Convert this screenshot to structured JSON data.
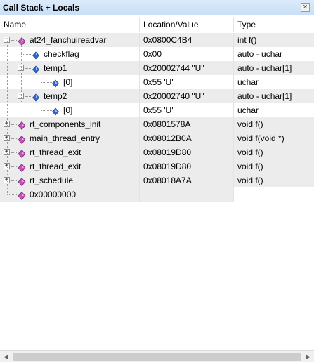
{
  "window": {
    "title": "Call Stack + Locals",
    "close_glyph": "×"
  },
  "columns": {
    "name": "Name",
    "location": "Location/Value",
    "type": "Type"
  },
  "rows": [
    {
      "name": "at24_fanchuireadvar",
      "location": "0x0800C4B4",
      "type": "int f()",
      "icon": "function-icon",
      "expander": "−"
    },
    {
      "name": "checkflag",
      "location": "0x00",
      "type": "auto - uchar",
      "icon": "variable-icon",
      "expander": ""
    },
    {
      "name": "temp1",
      "location": "0x20002744 \"U\"",
      "type": "auto - uchar[1]",
      "icon": "variable-icon",
      "expander": "−"
    },
    {
      "name": "[0]",
      "location": "0x55 'U'",
      "type": "uchar",
      "icon": "variable-icon",
      "expander": ""
    },
    {
      "name": "temp2",
      "location": "0x20002740 \"U\"",
      "type": "auto - uchar[1]",
      "icon": "variable-icon",
      "expander": "−"
    },
    {
      "name": "[0]",
      "location": "0x55 'U'",
      "type": "uchar",
      "icon": "variable-icon",
      "expander": ""
    },
    {
      "name": "rt_components_init",
      "location": "0x0801578A",
      "type": "void f()",
      "icon": "function-icon",
      "expander": "+"
    },
    {
      "name": "main_thread_entry",
      "location": "0x08012B0A",
      "type": "void f(void *)",
      "icon": "function-icon",
      "expander": "+"
    },
    {
      "name": "rt_thread_exit",
      "location": "0x08019D80",
      "type": "void f()",
      "icon": "function-icon",
      "expander": "+"
    },
    {
      "name": "rt_thread_exit",
      "location": "0x08019D80",
      "type": "void f()",
      "icon": "function-icon",
      "expander": "+"
    },
    {
      "name": "rt_schedule",
      "location": "0x08018A7A",
      "type": "void f()",
      "icon": "function-icon",
      "expander": "+"
    },
    {
      "name": "0x00000000",
      "location": "",
      "type": "",
      "icon": "function-icon",
      "expander": ""
    }
  ],
  "scrollbar": {
    "left_arrow": "◀",
    "right_arrow": "▶"
  },
  "colors": {
    "function_icon": "#c94fc0",
    "variable_icon": "#2f66d6",
    "row_shade": "#ececec"
  }
}
